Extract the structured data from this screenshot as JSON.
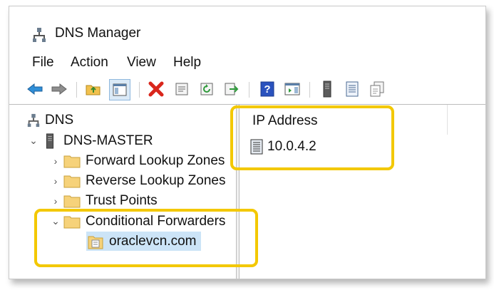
{
  "window": {
    "title": "DNS Manager"
  },
  "menu": [
    "File",
    "Action",
    "View",
    "Help"
  ],
  "toolbar": {
    "buttons": [
      "back-icon",
      "forward-icon",
      "up-folder-icon",
      "show-hide-tree-icon",
      "delete-icon",
      "properties-icon",
      "refresh-icon",
      "export-icon",
      "help-icon",
      "action-pane-icon",
      "server-icon",
      "list-view-icon",
      "copy-icon"
    ]
  },
  "tree": {
    "root": "DNS",
    "server": "DNS-MASTER",
    "items": [
      {
        "label": "Forward Lookup Zones",
        "expanded": false
      },
      {
        "label": "Reverse Lookup Zones",
        "expanded": false
      },
      {
        "label": "Trust Points",
        "expanded": false
      },
      {
        "label": "Conditional Forwarders",
        "expanded": true
      }
    ],
    "child": "oraclevcn.com"
  },
  "list": {
    "header": "IP Address",
    "rows": [
      "10.0.4.2"
    ]
  },
  "colors": {
    "highlight": "#f3c800",
    "selection": "#cce4f7"
  }
}
